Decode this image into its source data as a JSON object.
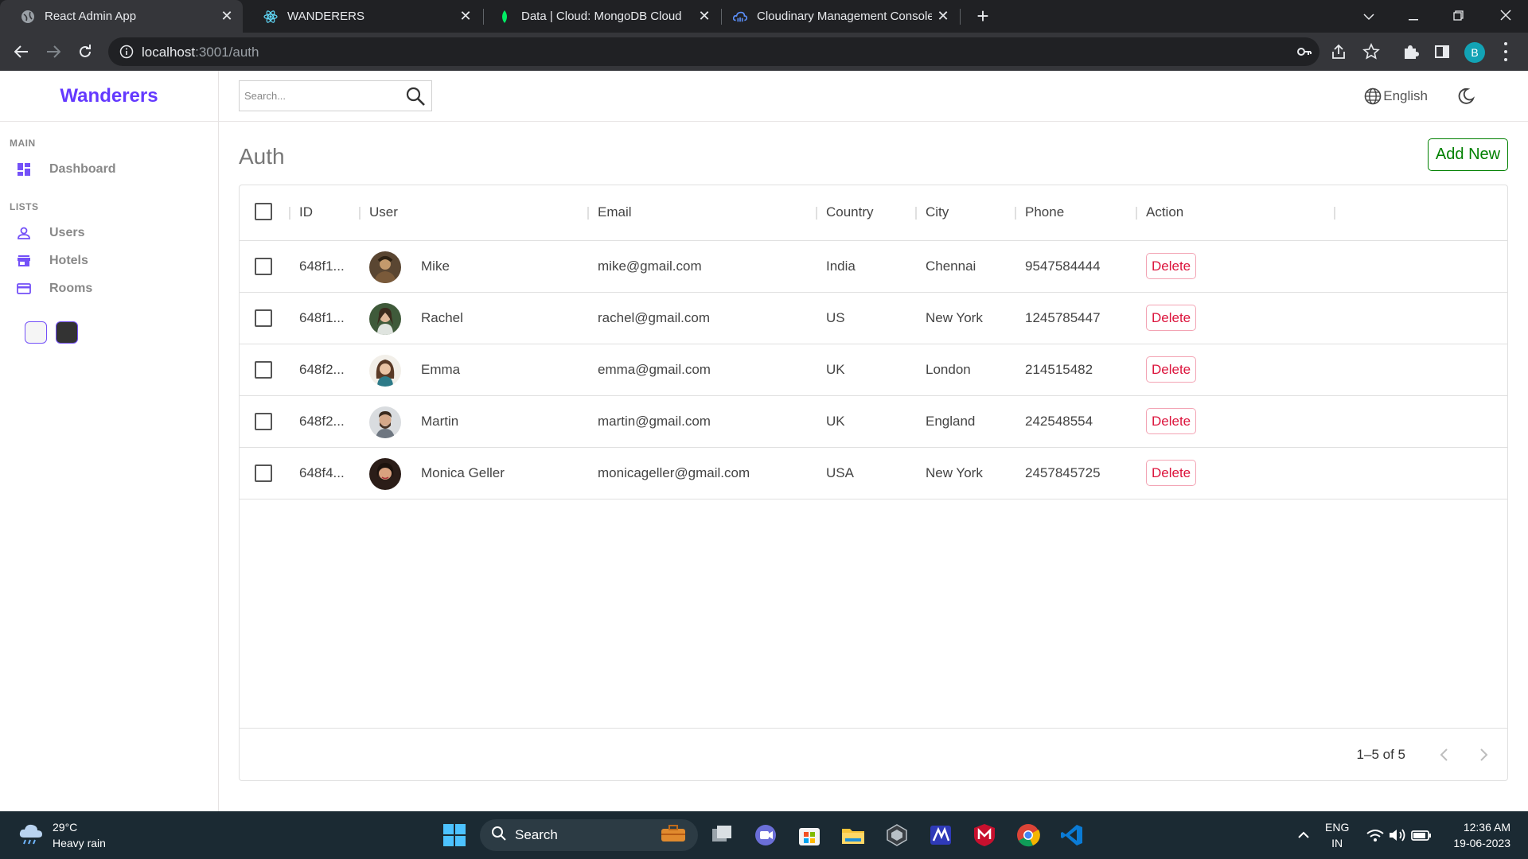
{
  "browser": {
    "tabs": [
      {
        "title": "React Admin App",
        "active": true
      },
      {
        "title": "WANDERERS",
        "active": false
      },
      {
        "title": "Data | Cloud: MongoDB Cloud",
        "active": false
      },
      {
        "title": "Cloudinary Management Console",
        "active": false
      }
    ],
    "url_host": "localhost",
    "url_rest": ":3001/auth",
    "profile_initial": "B"
  },
  "sidebar": {
    "logo": "Wanderers",
    "main_title": "MAIN",
    "dashboard": "Dashboard",
    "lists_title": "LISTS",
    "users": "Users",
    "hotels": "Hotels",
    "rooms": "Rooms"
  },
  "navbar": {
    "search_placeholder": "Search...",
    "language": "English"
  },
  "page": {
    "title": "Auth",
    "add_new": "Add New"
  },
  "table": {
    "columns": {
      "id": "ID",
      "user": "User",
      "email": "Email",
      "country": "Country",
      "city": "City",
      "phone": "Phone",
      "action": "Action"
    },
    "delete_label": "Delete",
    "rows": [
      {
        "id": "648f1...",
        "user": "Mike",
        "email": "mike@gmail.com",
        "country": "India",
        "city": "Chennai",
        "phone": "9547584444"
      },
      {
        "id": "648f1...",
        "user": "Rachel",
        "email": "rachel@gmail.com",
        "country": "US",
        "city": "New York",
        "phone": "1245785447"
      },
      {
        "id": "648f2...",
        "user": "Emma",
        "email": "emma@gmail.com",
        "country": "UK",
        "city": "London",
        "phone": "214515482"
      },
      {
        "id": "648f2...",
        "user": "Martin",
        "email": "martin@gmail.com",
        "country": "UK",
        "city": "England",
        "phone": "242548554"
      },
      {
        "id": "648f4...",
        "user": "Monica Geller",
        "email": "monicageller@gmail.com",
        "country": "USA",
        "city": "New York",
        "phone": "2457845725"
      }
    ],
    "pagination": "1–5 of 5"
  },
  "taskbar": {
    "temperature": "29°C",
    "weather": "Heavy rain",
    "search": "Search",
    "lang_top": "ENG",
    "lang_bottom": "IN",
    "time": "12:36 AM",
    "date": "19-06-2023"
  },
  "colors": {
    "brand": "#6439ff",
    "add_button": "#008000",
    "delete": "#dc143c"
  }
}
